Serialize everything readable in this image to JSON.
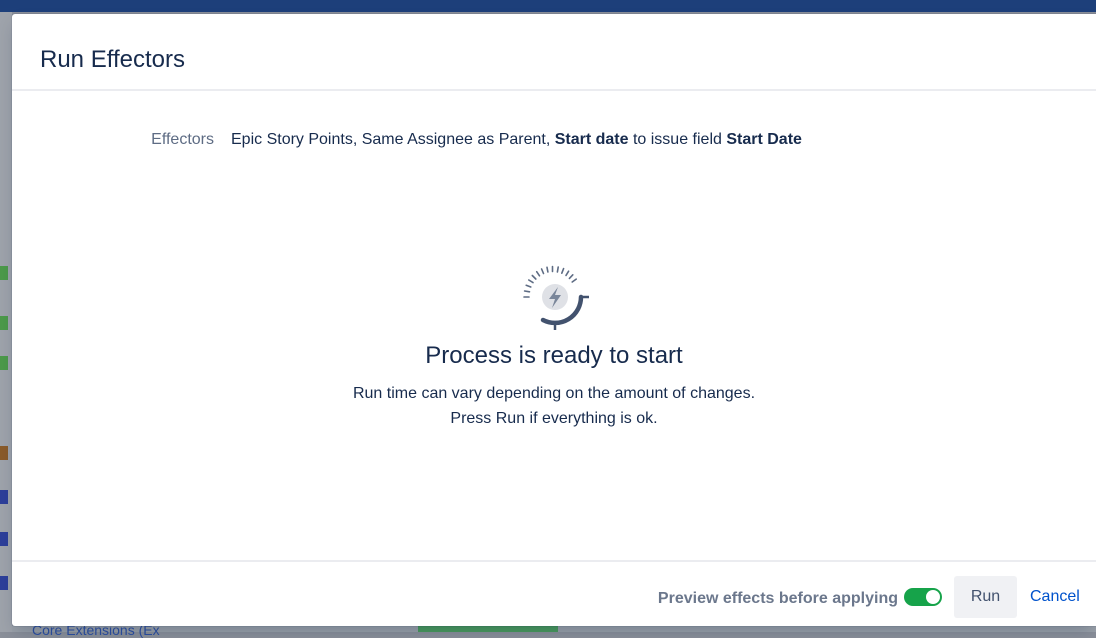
{
  "modal": {
    "title": "Run Effectors",
    "effectors_label": "Effectors",
    "effectors_text_1": "Epic Story Points, Same Assignee as Parent, ",
    "effectors_bold_1": "Start date",
    "effectors_text_2": " to issue field ",
    "effectors_bold_2": "Start Date"
  },
  "status": {
    "icon": "lightning-gauge-icon",
    "title": "Process is ready to start",
    "line1": "Run time can vary depending on the amount of changes.",
    "line2": "Press Run if everything is ok."
  },
  "footer": {
    "preview_label": "Preview effects before applying",
    "preview_enabled": true,
    "run_label": "Run",
    "cancel_label": "Cancel"
  },
  "background": {
    "bottom_text": "Core Extensions (Ex"
  },
  "colors": {
    "toggle_on": "#16a34a",
    "link": "#0052cc",
    "muted_label": "#5e6c84",
    "topbar": "#1d3f7a"
  }
}
